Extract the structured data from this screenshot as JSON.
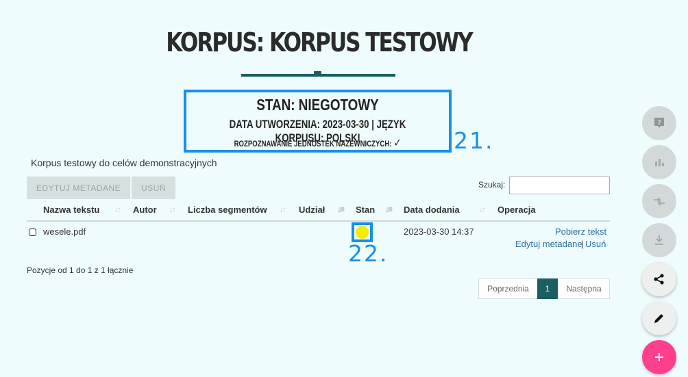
{
  "header": {
    "title": "KORPUS: KORPUS TESTOWY",
    "status": "STAN: NIEGOTOWY",
    "created_info": "DATA UTWORZENIA: 2023-03-30 | JĘZYK KORPUSU: POLSKI",
    "ner_label": "ROZPOZNAWANIE JEDNOSTEK NAZEWNICZYCH:",
    "ner_value": "✓"
  },
  "annotations": {
    "first": "21.",
    "second": "22."
  },
  "description": "Korpus testowy do celów demonstracyjnych",
  "toolbar": {
    "edit_metadata": "EDYTUJ METADANE",
    "delete": "USUŃ"
  },
  "search": {
    "label": "Szukaj:",
    "value": ""
  },
  "table": {
    "columns": [
      "Nazwa tekstu",
      "Autor",
      "Liczba segmentów",
      "Udział",
      "Stan",
      "Data dodania",
      "Operacja"
    ],
    "rows": [
      {
        "name": "wesele.pdf",
        "author": "",
        "segments": "",
        "share": "",
        "state_color": "#f2ee00",
        "date": "2023-03-30 14:37",
        "op_download": "Pobierz tekst",
        "op_edit": "Edytuj metadane",
        "op_sep": "|",
        "op_delete": "Usuń"
      }
    ]
  },
  "pagination": {
    "info": "Pozycje od 1 do 1 z 1 łącznie",
    "prev": "Poprzednia",
    "current": "1",
    "next": "Następna"
  },
  "fabs": [
    "help-icon",
    "chart-icon",
    "compare-icon",
    "download-icon",
    "share-icon",
    "edit-icon",
    "plus-icon"
  ],
  "colors": {
    "accent": "#1c5e60",
    "annotation": "#1a8fe6",
    "fab_primary": "#ff3f8e",
    "background": "#eefcfd"
  }
}
